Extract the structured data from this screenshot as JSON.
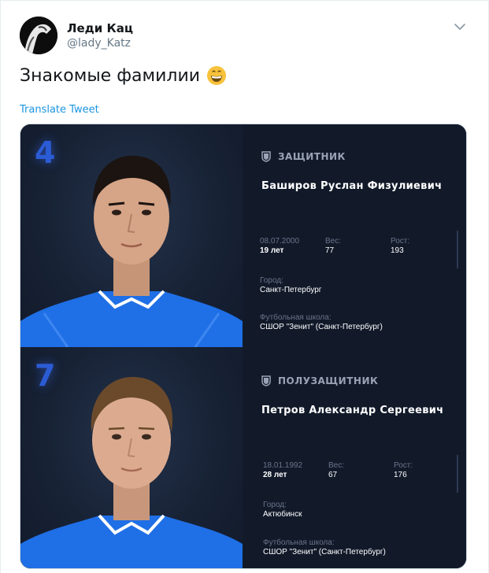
{
  "author": {
    "name": "Леди Кац",
    "handle": "@lady_Katz"
  },
  "tweet": {
    "text": "Знакомые фамилии",
    "emoji": "grinning-face-emoji",
    "translate_label": "Translate Tweet"
  },
  "icons": {
    "menu": "chevron-down-icon",
    "position": "shield-icon"
  },
  "colors": {
    "link": "#1b95e0",
    "card_bg": "#121a2a",
    "number": "#2b5cd6",
    "jersey": "#1f6fe6"
  },
  "players": [
    {
      "number": "4",
      "position": "ЗАЩИТНИК",
      "name": "Баширов Руслан Физулиевич",
      "birth_date": "08.07.2000",
      "age": "19 лет",
      "weight_label": "Вес:",
      "weight": "77",
      "height_label": "Рост:",
      "height": "193",
      "city_label": "Город:",
      "city": "Санкт-Петербург",
      "school_label": "Футбольная школа:",
      "school": "СШОР \"Зенит\" (Санкт-Петербург)"
    },
    {
      "number": "7",
      "position": "ПОЛУЗАЩИТНИК",
      "name": "Петров Александр Сергеевич",
      "birth_date": "18.01.1992",
      "age": "28 лет",
      "weight_label": "Вес:",
      "weight": "67",
      "height_label": "Рост:",
      "height": "176",
      "city_label": "Город:",
      "city": "Актюбинск",
      "school_label": "Футбольная школа:",
      "school": "СШОР \"Зенит\" (Санкт-Петербург)"
    }
  ]
}
